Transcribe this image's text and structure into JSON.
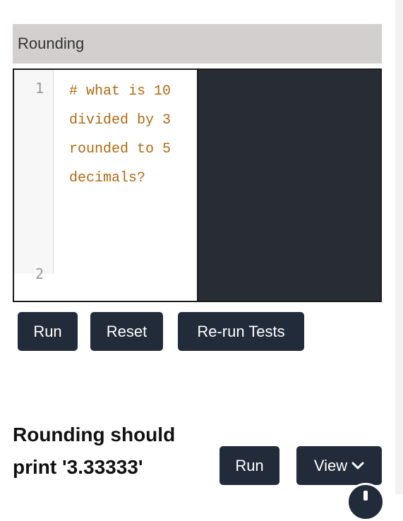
{
  "exercise": {
    "title": "Rounding",
    "code_lines": [
      {
        "number": "1",
        "text": "# what is 10 divided by 3 rounded to 5 decimals?"
      },
      {
        "number": "2",
        "text": ""
      }
    ]
  },
  "controls": {
    "run_label": "Run",
    "reset_label": "Reset",
    "rerun_tests_label": "Re-run Tests"
  },
  "test": {
    "title": "Rounding should print '3.33333'",
    "run_label": "Run",
    "view_label": "View"
  },
  "icons": {
    "view_dropdown": "chevron-down-icon",
    "floating": "info-icon"
  },
  "colors": {
    "title_bar": "#d3cfcf",
    "button": "#222b3a",
    "output_bg": "#282c34",
    "code_comment": "#b06a12"
  }
}
